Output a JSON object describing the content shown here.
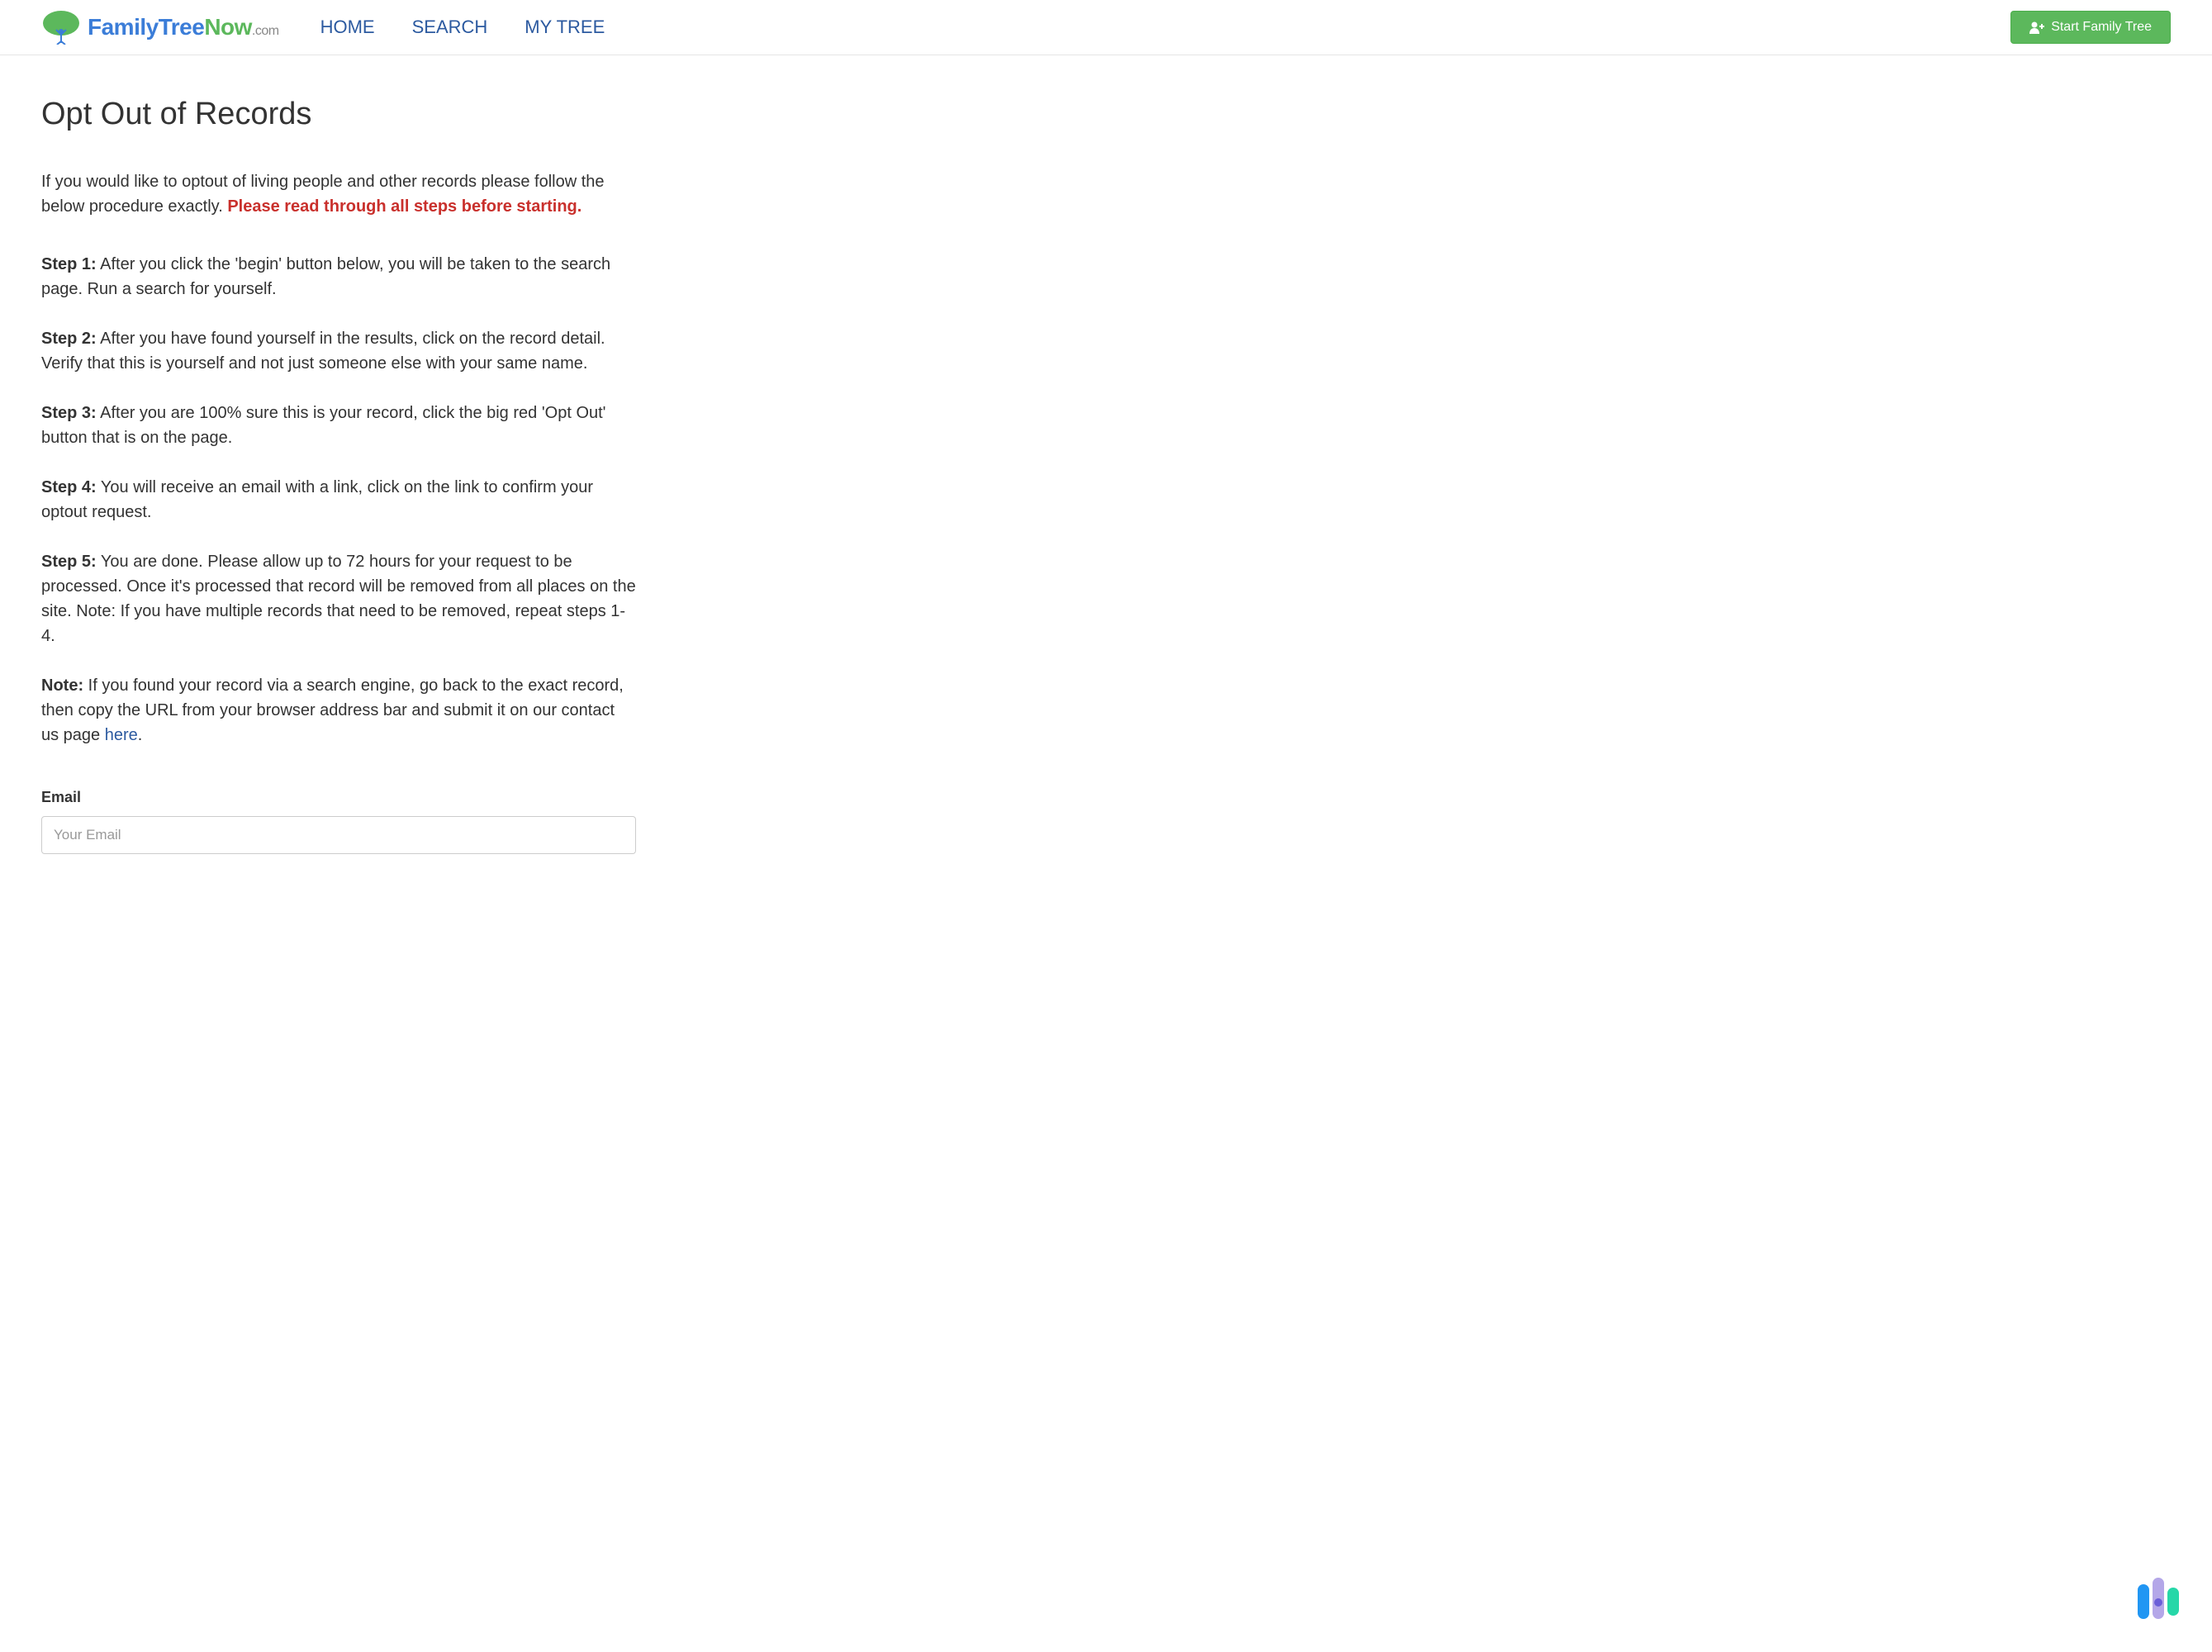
{
  "logo": {
    "family": "Family",
    "tree": "Tree",
    "now": "Now",
    "dotcom": ".com"
  },
  "nav": {
    "home": "HOME",
    "search": "SEARCH",
    "mytree": "MY TREE"
  },
  "cta": {
    "start": "Start Family Tree"
  },
  "page": {
    "title": "Opt Out of Records",
    "intro_text": "If you would like to optout of living people and other records please follow the below procedure exactly. ",
    "intro_warning": "Please read through all steps before starting.",
    "steps": [
      {
        "label": "Step 1:",
        "text": " After you click the 'begin' button below, you will be taken to the search page. Run a search for yourself."
      },
      {
        "label": "Step 2:",
        "text": " After you have found yourself in the results, click on the record detail. Verify that this is yourself and not just someone else with your same name."
      },
      {
        "label": "Step 3:",
        "text": " After you are 100% sure this is your record, click the big red 'Opt Out' button that is on the page."
      },
      {
        "label": "Step 4:",
        "text": " You will receive an email with a link, click on the link to confirm your optout request."
      },
      {
        "label": "Step 5:",
        "text": " You are done. Please allow up to 72 hours for your request to be processed. Once it's processed that record will be removed from all places on the site. Note: If you have multiple records that need to be removed, repeat steps 1-4."
      }
    ],
    "note_label": "Note:",
    "note_text": " If you found your record via a search engine, go back to the exact record, then copy the URL from your browser address bar and submit it on our contact us page ",
    "note_link": "here",
    "note_period": "."
  },
  "form": {
    "email_label": "Email",
    "email_placeholder": "Your Email"
  }
}
